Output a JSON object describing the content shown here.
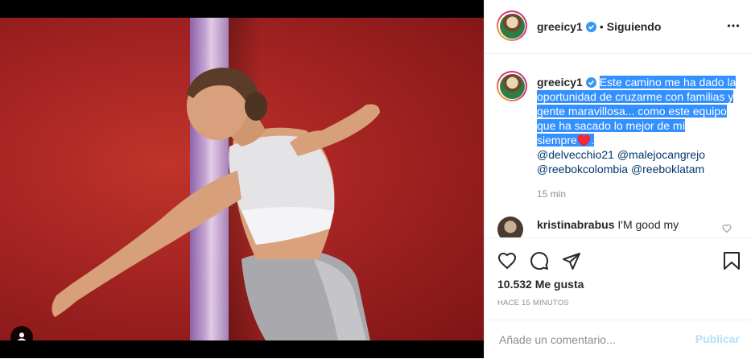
{
  "post": {
    "username": "greeicy1",
    "dot": "•",
    "follow_state": "Siguiendo",
    "more_icon": "more-horizontal-icon"
  },
  "caption": {
    "username": "greeicy1",
    "text": "Este camino me ha dado la oportunidad de cruzarme con familias y gente maravillosa... como este equipo que ha sacado lo mejor de mí siempre♥️.",
    "mentions": [
      "@delvecchio21",
      "@malejocangrejo",
      "@reebokcolombia",
      "@reeboklatam"
    ],
    "time": "15 min"
  },
  "comment": {
    "username": "kristinabrabus",
    "text": "I'M good my"
  },
  "stats": {
    "likes": "10.532 Me gusta",
    "ago": "HACE 15 MINUTOS"
  },
  "add_comment": {
    "placeholder": "Añade un comentario...",
    "publish": "Publicar"
  },
  "colors": {
    "accent": "#3897f0",
    "highlight": "#3390ff",
    "mention": "#00376b",
    "publish_disabled": "#b2dffc"
  }
}
